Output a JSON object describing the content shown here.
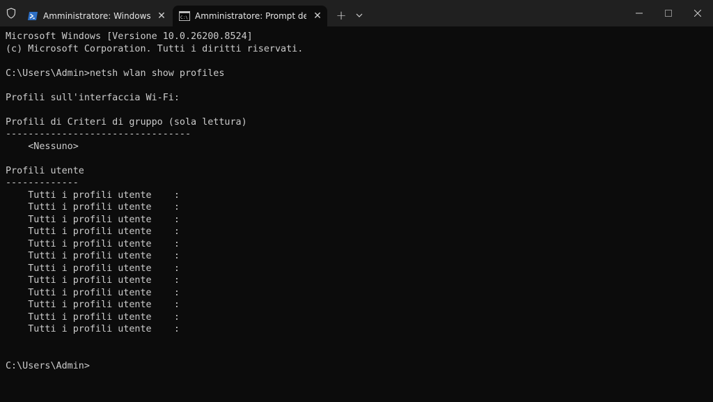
{
  "tabs": [
    {
      "title": "Amministratore: Windows PowerShell",
      "icon": "powershell-icon",
      "active": false
    },
    {
      "title": "Amministratore: Prompt dei comandi",
      "icon": "cmd-icon",
      "active": true
    }
  ],
  "tabbar": {
    "new_tab_label": "+",
    "close_tab_glyph": "✕"
  },
  "terminal": {
    "lines": [
      "Microsoft Windows [Versione 10.0.26200.8524]",
      "(c) Microsoft Corporation. Tutti i diritti riservati.",
      "",
      "C:\\Users\\Admin>netsh wlan show profiles",
      "",
      "Profili sull'interfaccia Wi-Fi:",
      "",
      "Profili di Criteri di gruppo (sola lettura)",
      "---------------------------------",
      "    <Nessuno>",
      "",
      "Profili utente",
      "-------------",
      "    Tutti i profili utente    :",
      "    Tutti i profili utente    :",
      "    Tutti i profili utente    :",
      "    Tutti i profili utente    :",
      "    Tutti i profili utente    :",
      "    Tutti i profili utente    :",
      "    Tutti i profili utente    :",
      "    Tutti i profili utente    :",
      "    Tutti i profili utente    :",
      "    Tutti i profili utente    :",
      "    Tutti i profili utente    :",
      "    Tutti i profili utente    :",
      "",
      "",
      "C:\\Users\\Admin>"
    ]
  },
  "colors": {
    "terminal_bg": "#0c0c0c",
    "tabbar_bg": "#202020",
    "text": "#cccccc",
    "powershell_accent": "#3a82d6"
  }
}
